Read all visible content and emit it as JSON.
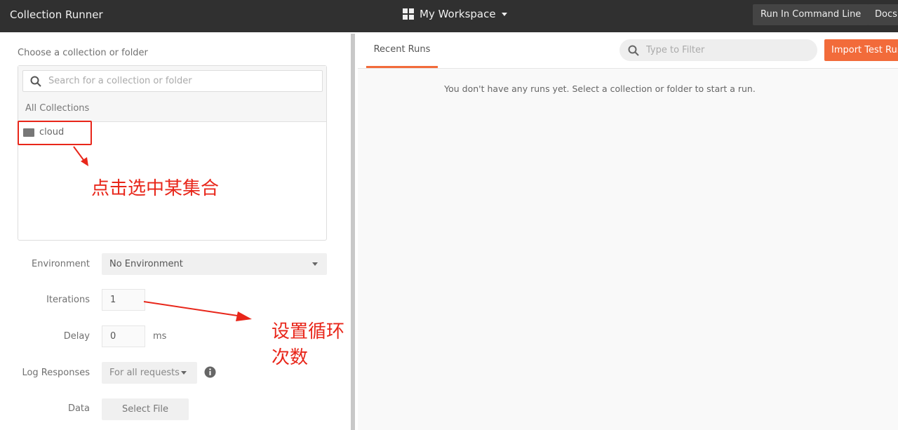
{
  "header": {
    "title": "Collection Runner",
    "workspace": "My Workspace",
    "run_cli": "Run In Command Line",
    "docs": "Docs"
  },
  "left": {
    "choose_label": "Choose a collection or folder",
    "search_placeholder": "Search for a collection or folder",
    "all_collections": "All Collections",
    "collections": [
      {
        "name": "cloud"
      }
    ],
    "environment": {
      "label": "Environment",
      "value": "No Environment"
    },
    "iterations": {
      "label": "Iterations",
      "value": "1"
    },
    "delay": {
      "label": "Delay",
      "value": "0",
      "unit": "ms"
    },
    "log_responses": {
      "label": "Log Responses",
      "value": "For all requests"
    },
    "data": {
      "label": "Data",
      "button": "Select File"
    }
  },
  "right": {
    "tab": "Recent Runs",
    "filter_placeholder": "Type to Filter",
    "import": "Import Test Run",
    "empty": "You don't have any runs yet. Select a collection or folder to start a run."
  },
  "annotations": {
    "select_collection": "点击选中某集合",
    "set_iterations": "设置循环次数"
  },
  "colors": {
    "accent": "#f26b3a",
    "annotation": "#e8261a",
    "header": "#303030"
  }
}
